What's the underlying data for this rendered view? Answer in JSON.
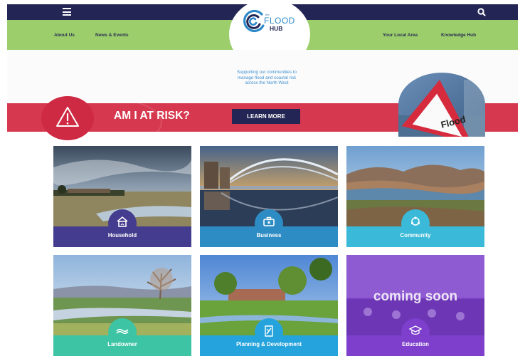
{
  "header": {
    "nav_left": [
      "About Us",
      "News & Events"
    ],
    "nav_right": [
      "Your Local Area",
      "Knowledge Hub"
    ],
    "logo": {
      "small": "the",
      "main": "FLOOD",
      "sub": "HUB"
    }
  },
  "hero": {
    "tagline_lines": [
      "Supporting our communities to",
      "manage flood and coastal risk",
      "across the North West"
    ]
  },
  "risk_banner": {
    "title": "AM I AT RISK?",
    "button": "LEARN MORE",
    "sign_text": "Flood"
  },
  "tiles": [
    {
      "label": "Household",
      "icon": "house-icon",
      "band_color": "#443c8e"
    },
    {
      "label": "Business",
      "icon": "briefcase-icon",
      "band_color": "#2e8cc4"
    },
    {
      "label": "Community",
      "icon": "community-icon",
      "band_color": "#3ab9d8"
    },
    {
      "label": "Landowner",
      "icon": "tractor-icon",
      "band_color": "#3cc4a4"
    },
    {
      "label": "Planning & Development",
      "icon": "planning-icon",
      "band_color": "#25a3dc"
    },
    {
      "label": "Education",
      "icon": "graduation-cap-icon",
      "band_color": "#7d3fcc",
      "overlay": "coming soon"
    }
  ],
  "colors": {
    "navy": "#232654",
    "green": "#9ccf6c",
    "red": "#d6384f"
  }
}
